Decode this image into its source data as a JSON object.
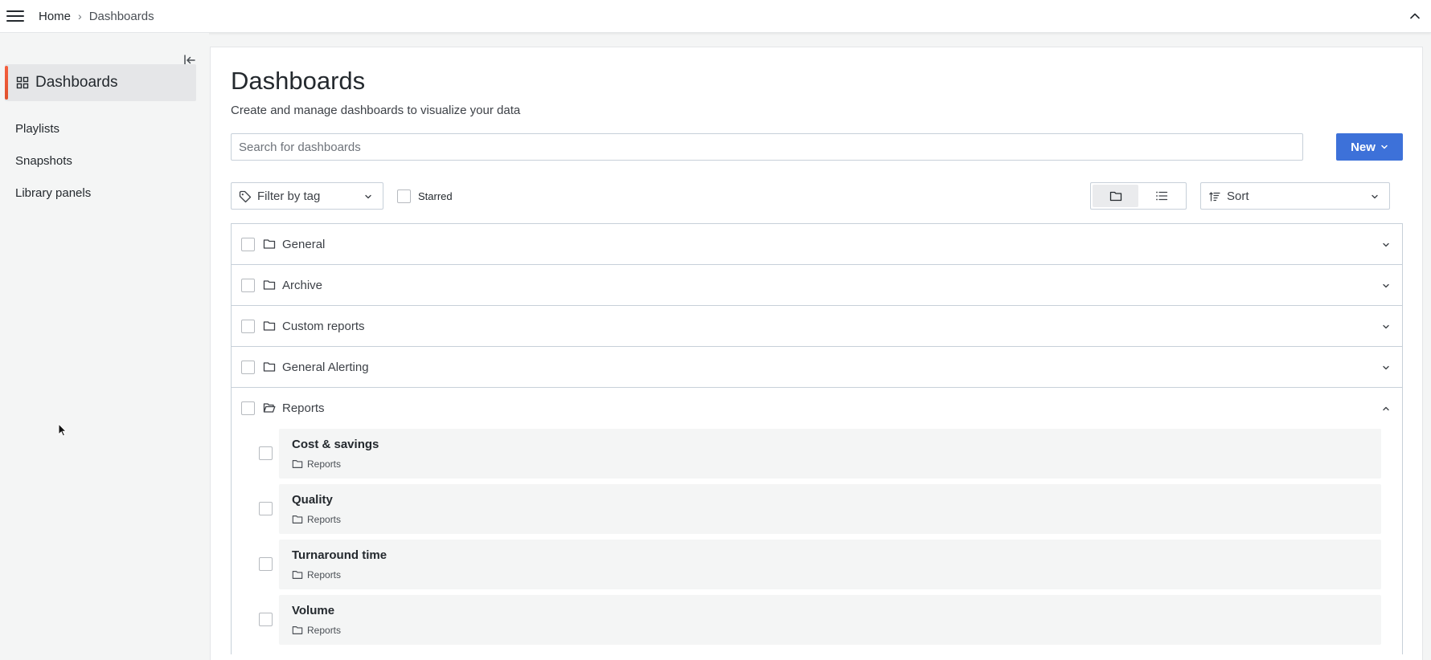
{
  "topbar": {
    "breadcrumb_home": "Home",
    "breadcrumb_separator": "›",
    "breadcrumb_current": "Dashboards"
  },
  "sidebar": {
    "active_item": "Dashboards",
    "items": [
      "Playlists",
      "Snapshots",
      "Library panels"
    ]
  },
  "main": {
    "title": "Dashboards",
    "subtitle": "Create and manage dashboards to visualize your data",
    "search_placeholder": "Search for dashboards",
    "new_label": "New",
    "filter_tag_label": "Filter by tag",
    "starred_label": "Starred",
    "sort_label": "Sort",
    "folders": [
      {
        "name": "General",
        "expanded": false
      },
      {
        "name": "Archive",
        "expanded": false
      },
      {
        "name": "Custom reports",
        "expanded": false
      },
      {
        "name": "General Alerting",
        "expanded": false
      },
      {
        "name": "Reports",
        "expanded": true
      }
    ],
    "dashboards": [
      {
        "title": "Cost & savings",
        "folder": "Reports"
      },
      {
        "title": "Quality",
        "folder": "Reports"
      },
      {
        "title": "Turnaround time",
        "folder": "Reports"
      },
      {
        "title": "Volume",
        "folder": "Reports"
      }
    ]
  },
  "colors": {
    "accent_primary": "#3d71d9",
    "active_indicator": "#f55f3e",
    "sidebar_bg": "#f4f5f5",
    "border": "#c7d0d9"
  },
  "icons": {
    "hamburger": "menu-icon",
    "collapse_top": "chevron-up-icon",
    "dock": "dock-left-icon",
    "dashboards": "apps-grid-icon",
    "tag": "tag-icon",
    "folder": "folder-icon",
    "folder_open": "folder-open-icon",
    "list_view": "list-icon",
    "sort": "sort-amount-icon"
  }
}
